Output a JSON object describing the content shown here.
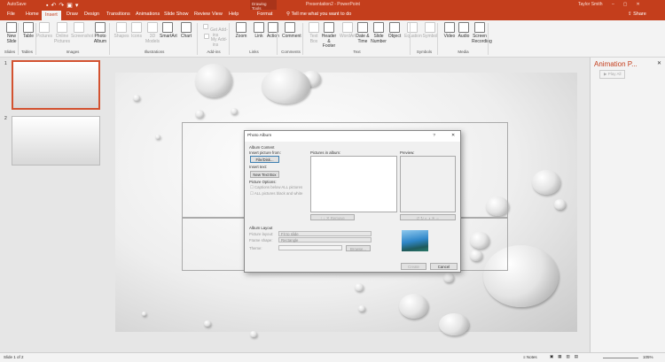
{
  "titlebar": {
    "autosave": "AutoSave",
    "context": "Drawing Tools",
    "title": "Presentation2 - PowerPoint",
    "user": "Taylor Smith"
  },
  "tabs": [
    "File",
    "Home",
    "Insert",
    "Draw",
    "Design",
    "Transitions",
    "Animations",
    "Slide Show",
    "Review",
    "View",
    "Help",
    "Format"
  ],
  "active_tab": "Insert",
  "tell_me": "Tell me what you want to do",
  "share": "Share",
  "ribbon": {
    "groups": [
      "Slides",
      "Tables",
      "Images",
      "Illustrations",
      "Add-ins",
      "Links",
      "Comments",
      "Text",
      "Symbols",
      "Media"
    ],
    "buttons": [
      "New Slide",
      "Table",
      "Pictures",
      "Online Pictures",
      "Screenshot",
      "Photo Album",
      "Shapes",
      "Icons",
      "3D Models",
      "SmartArt",
      "Chart",
      "Get Add-ins",
      "My Add-ins",
      "Zoom",
      "Link",
      "Action",
      "Comment",
      "Text Box",
      "Header & Footer",
      "WordArt",
      "Date & Time",
      "Slide Number",
      "Object",
      "Equation",
      "Symbol",
      "Video",
      "Audio",
      "Screen Recording"
    ]
  },
  "slides": [
    "1",
    "2"
  ],
  "animation_pane": {
    "title": "Animation P...",
    "play": "Play All"
  },
  "dialog": {
    "title": "Photo Album",
    "help": "?",
    "close": "✕",
    "album_content": "Album Content",
    "insert_from": "Insert picture from:",
    "file_disk": "File/Disk...",
    "insert_text": "Insert text:",
    "new_text_box": "New Text Box",
    "picture_options": "Picture Options:",
    "captions": "Captions below ALL pictures",
    "bw": "ALL pictures black and white",
    "pictures_in_album": "Pictures in album:",
    "preview": "Preview:",
    "remove": "Remove",
    "album_layout": "Album Layout",
    "picture_layout_label": "Picture layout:",
    "picture_layout": "Fit to slide",
    "frame_shape_label": "Frame shape:",
    "frame_shape": "Rectangle",
    "theme_label": "Theme:",
    "browse": "Browse...",
    "create": "Create",
    "cancel": "Cancel"
  },
  "status": {
    "slide": "Slide 1 of 2",
    "notes": "Notes",
    "zoom": "105%"
  },
  "colors": {
    "accent": "#c43e1c"
  }
}
